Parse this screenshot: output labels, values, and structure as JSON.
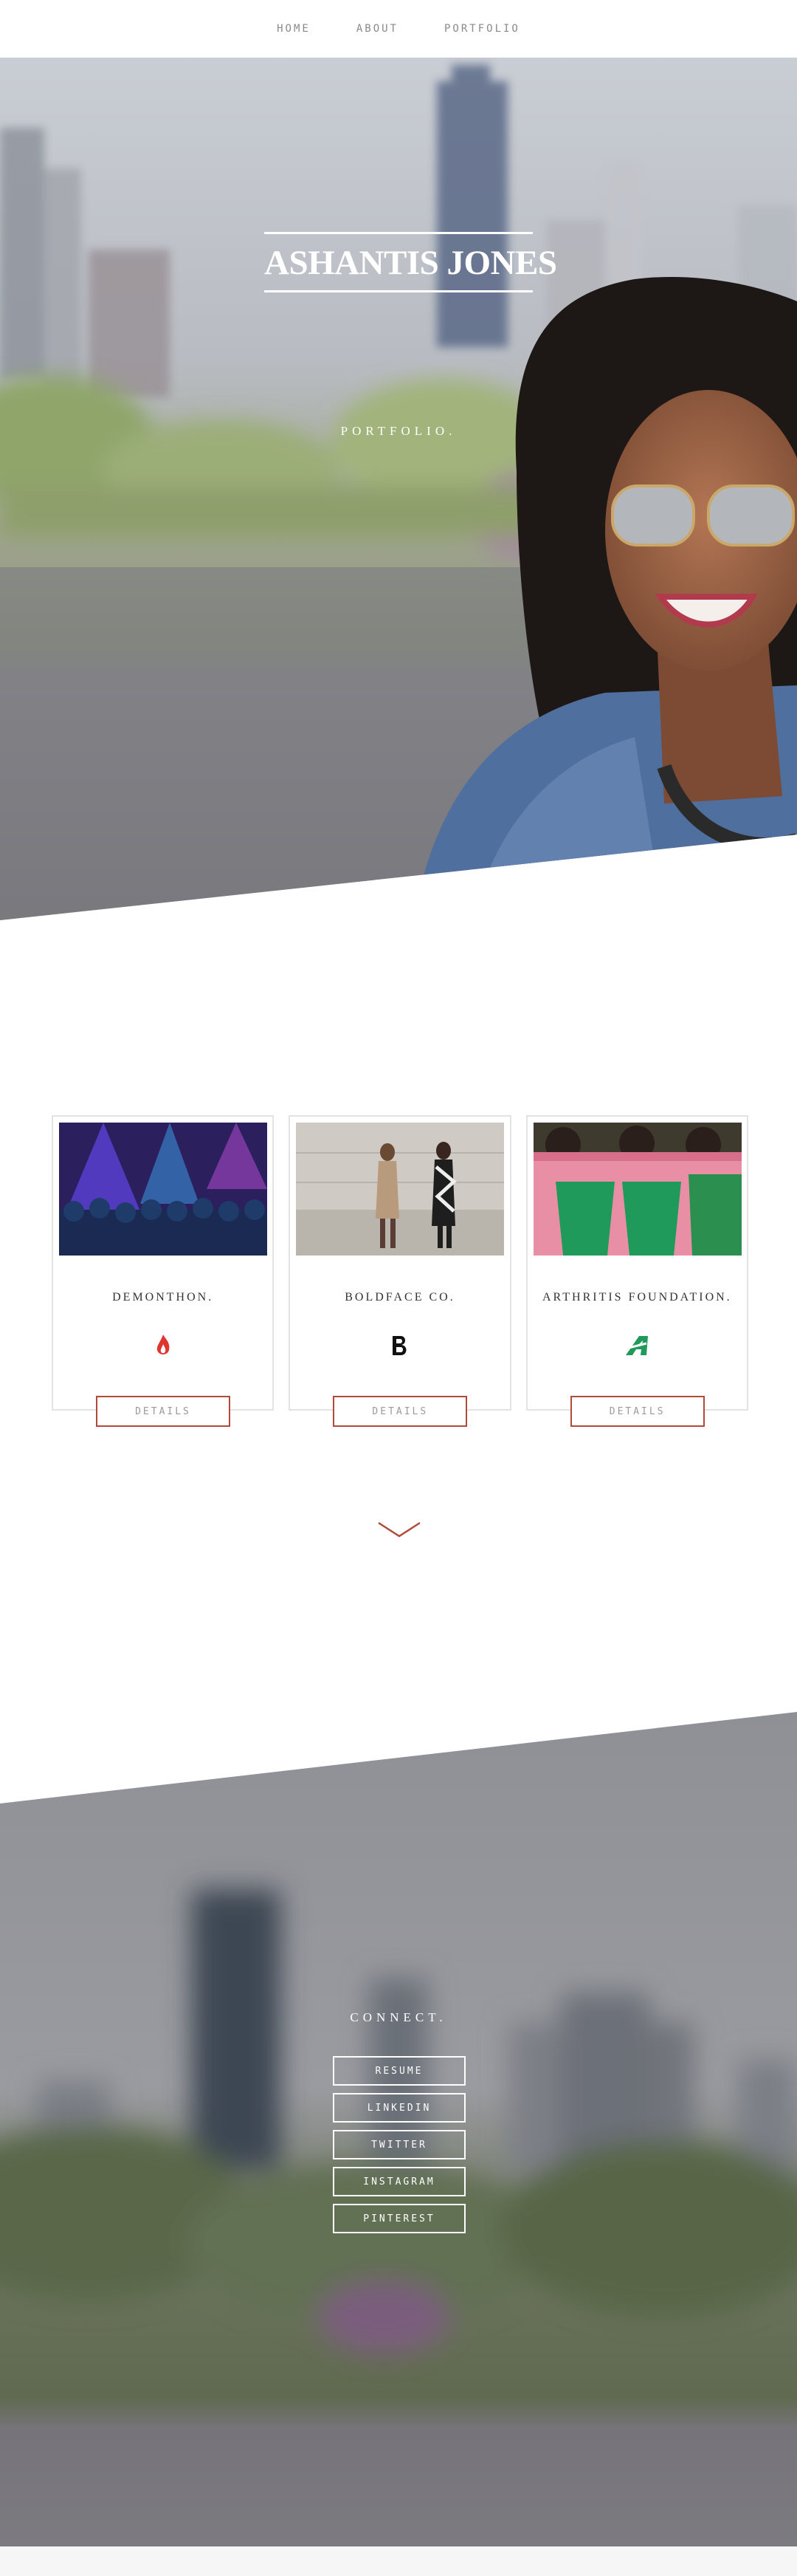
{
  "nav": {
    "items": [
      {
        "label": "HOME"
      },
      {
        "label": "ABOUT"
      },
      {
        "label": "PORTFOLIO"
      }
    ]
  },
  "hero": {
    "title": "ASHANTIS JONES",
    "subtitle": "PORTFOLIO."
  },
  "portfolio": {
    "cards": [
      {
        "title": "DEMONTHON.",
        "logo_icon": "flame-icon",
        "button_label": "DETAILS",
        "logo_color": "#e0352f"
      },
      {
        "title": "BOLDFACE CO.",
        "logo_icon": "letter-b-icon",
        "button_label": "DETAILS",
        "logo_color": "#111111"
      },
      {
        "title": "ARTHRITIS FOUNDATION.",
        "logo_icon": "arthritis-a-icon",
        "button_label": "DETAILS",
        "logo_color": "#1f9a5a"
      }
    ],
    "scroll_icon": "chevron-down-icon"
  },
  "connect": {
    "title": "CONNECT.",
    "links": [
      {
        "label": "RESUME"
      },
      {
        "label": "LINKEDIN"
      },
      {
        "label": "TWITTER"
      },
      {
        "label": "INSTAGRAM"
      },
      {
        "label": "PINTEREST"
      }
    ]
  },
  "colors": {
    "accent": "#b04a3a",
    "border": "#e3e3e3",
    "nav_text": "#8a8a8a"
  }
}
